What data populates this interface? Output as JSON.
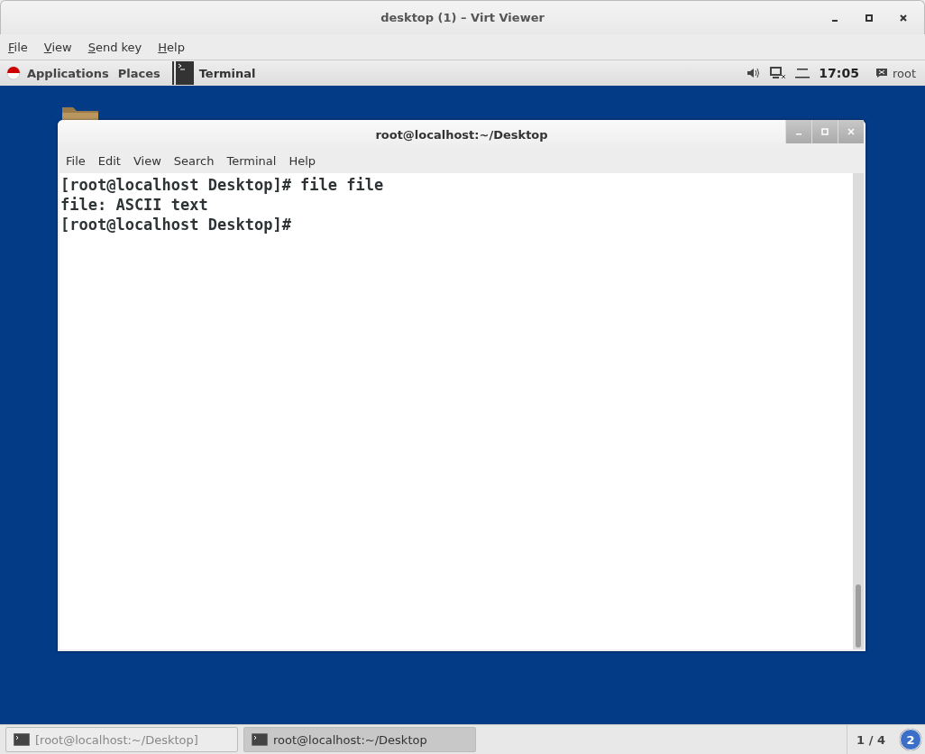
{
  "window": {
    "title": "desktop (1) – Virt Viewer"
  },
  "menu": [
    {
      "accel": "F",
      "rest": "ile"
    },
    {
      "accel": "V",
      "rest": "iew"
    },
    {
      "accel": "S",
      "rest": "end key"
    },
    {
      "accel": "H",
      "rest": "elp"
    }
  ],
  "top_bar": {
    "applications": "Applications",
    "places": "Places",
    "app": "Terminal",
    "clock": "17:05",
    "user": "root"
  },
  "terminal": {
    "title": "root@localhost:~/Desktop",
    "menu": [
      "File",
      "Edit",
      "View",
      "Search",
      "Terminal",
      "Help"
    ],
    "lines": [
      "[root@localhost Desktop]# file file",
      "file: ASCII text",
      "[root@localhost Desktop]#"
    ]
  },
  "taskbar": {
    "items": [
      {
        "label": "[root@localhost:~/Desktop]",
        "selected": false
      },
      {
        "label": "root@localhost:~/Desktop",
        "selected": true
      }
    ],
    "workspace": "1 / 4",
    "badge": "2"
  }
}
